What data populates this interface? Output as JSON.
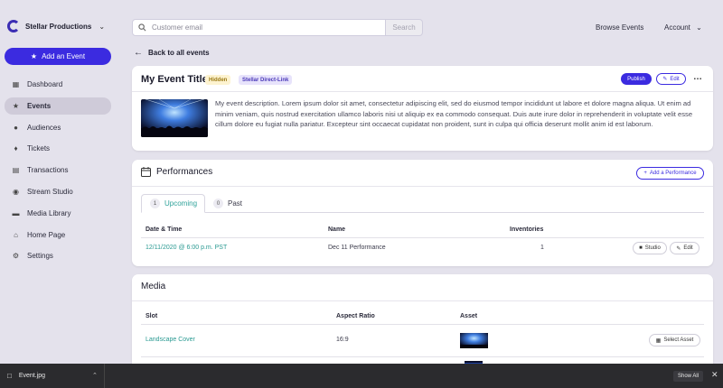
{
  "org": {
    "name": "Stellar Productions"
  },
  "sidebar": {
    "add_event_label": "Add an Event",
    "items": [
      {
        "label": "Dashboard",
        "icon": "grid-icon"
      },
      {
        "label": "Events",
        "icon": "star-icon"
      },
      {
        "label": "Audiences",
        "icon": "users-icon"
      },
      {
        "label": "Tickets",
        "icon": "ticket-icon"
      },
      {
        "label": "Transactions",
        "icon": "transactions-icon"
      },
      {
        "label": "Stream Studio",
        "icon": "stream-icon"
      },
      {
        "label": "Media Library",
        "icon": "folder-icon"
      },
      {
        "label": "Home Page",
        "icon": "home-icon"
      },
      {
        "label": "Settings",
        "icon": "gear-icon"
      }
    ],
    "active_index": 1
  },
  "topbar": {
    "search_placeholder": "Customer email",
    "search_button": "Search",
    "browse_events": "Browse Events",
    "account": "Account"
  },
  "back_label": "Back to all events",
  "event": {
    "title": "My Event Title",
    "badge_hidden": "Hidden",
    "badge_direct": "Stellar Direct-Link",
    "publish_label": "Publish",
    "edit_label": "Edit",
    "more_label": "…",
    "description": "My event description. Lorem ipsum dolor sit amet, consectetur adipiscing elit, sed do eiusmod tempor incididunt ut labore et dolore magna aliqua. Ut enim ad minim veniam, quis nostrud exercitation ullamco laboris nisi ut aliquip ex ea commodo consequat. Duis aute irure dolor in reprehenderit in voluptate velit esse cillum dolore eu fugiat nulla pariatur. Excepteur sint occaecat cupidatat non proident, sunt in culpa qui officia deserunt mollit anim id est laborum."
  },
  "performances": {
    "title": "Performances",
    "add_label": "Add a Performance",
    "tabs": [
      {
        "count": "1",
        "label": "Upcoming"
      },
      {
        "count": "0",
        "label": "Past"
      }
    ],
    "columns": [
      "Date & Time",
      "Name",
      "Inventories"
    ],
    "rows": [
      {
        "date": "12/11/2020 @ 6:00 p.m. PST",
        "name": "Dec 11 Performance",
        "inventories": "1",
        "studio_label": "Studio",
        "edit_label": "Edit"
      }
    ]
  },
  "media": {
    "title": "Media",
    "columns": [
      "Slot",
      "Aspect Ratio",
      "Asset"
    ],
    "rows": [
      {
        "slot": "Landscape Cover",
        "ratio": "16:9",
        "action": "Select Asset"
      }
    ]
  },
  "downloads": {
    "file_name": "Event.jpg",
    "show_all": "Show All"
  },
  "colors": {
    "accent": "#3b2be0",
    "link": "#2a9a92",
    "background": "#e4e2ec"
  }
}
